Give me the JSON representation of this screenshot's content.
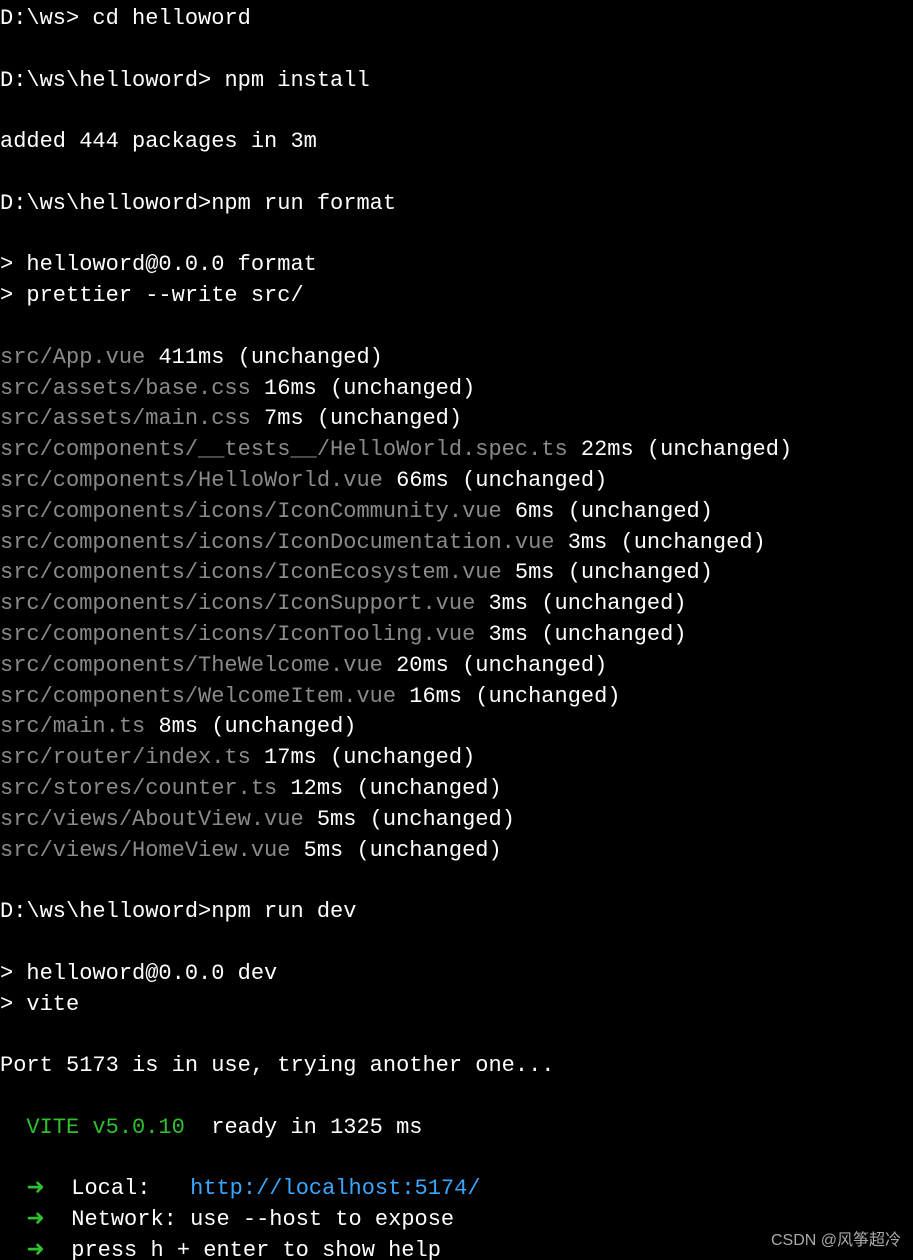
{
  "prompts": [
    {
      "prompt": "D:\\ws> ",
      "command": "cd helloword"
    },
    {
      "prompt": "D:\\ws\\helloword> ",
      "command": "npm install"
    }
  ],
  "install_result": "added 444 packages in 3m",
  "prompt_format": {
    "prompt": "D:\\ws\\helloword>",
    "command": "npm run format"
  },
  "format_header": [
    "> helloword@0.0.0 format",
    "> prettier --write src/"
  ],
  "prettier_files": [
    {
      "path": "src/App.vue ",
      "result": "411ms (unchanged)"
    },
    {
      "path": "src/assets/base.css ",
      "result": "16ms (unchanged)"
    },
    {
      "path": "src/assets/main.css ",
      "result": "7ms (unchanged)"
    },
    {
      "path": "src/components/__tests__/HelloWorld.spec.ts ",
      "result": "22ms (unchanged)"
    },
    {
      "path": "src/components/HelloWorld.vue ",
      "result": "66ms (unchanged)"
    },
    {
      "path": "src/components/icons/IconCommunity.vue ",
      "result": "6ms (unchanged)"
    },
    {
      "path": "src/components/icons/IconDocumentation.vue ",
      "result": "3ms (unchanged)"
    },
    {
      "path": "src/components/icons/IconEcosystem.vue ",
      "result": "5ms (unchanged)"
    },
    {
      "path": "src/components/icons/IconSupport.vue ",
      "result": "3ms (unchanged)"
    },
    {
      "path": "src/components/icons/IconTooling.vue ",
      "result": "3ms (unchanged)"
    },
    {
      "path": "src/components/TheWelcome.vue ",
      "result": "20ms (unchanged)"
    },
    {
      "path": "src/components/WelcomeItem.vue ",
      "result": "16ms (unchanged)"
    },
    {
      "path": "src/main.ts ",
      "result": "8ms (unchanged)"
    },
    {
      "path": "src/router/index.ts ",
      "result": "17ms (unchanged)"
    },
    {
      "path": "src/stores/counter.ts ",
      "result": "12ms (unchanged)"
    },
    {
      "path": "src/views/AboutView.vue ",
      "result": "5ms (unchanged)"
    },
    {
      "path": "src/views/HomeView.vue ",
      "result": "5ms (unchanged)"
    }
  ],
  "prompt_dev": {
    "prompt": "D:\\ws\\helloword>",
    "command": "npm run dev"
  },
  "dev_header": [
    "> helloword@0.0.0 dev",
    "> vite"
  ],
  "port_message": "Port 5173 is in use, trying another one...",
  "vite": {
    "label": "  VITE v5.0.10",
    "ready": "  ready in 1325 ms"
  },
  "vite_info": {
    "arrow": "  ➜  ",
    "local_label": "Local:   ",
    "local_url": "http://localhost:5174/",
    "network_label": "Network: ",
    "network_hint": "use --host to expose",
    "help": "press h + enter to show help"
  },
  "watermark": "CSDN @风筝超冷"
}
